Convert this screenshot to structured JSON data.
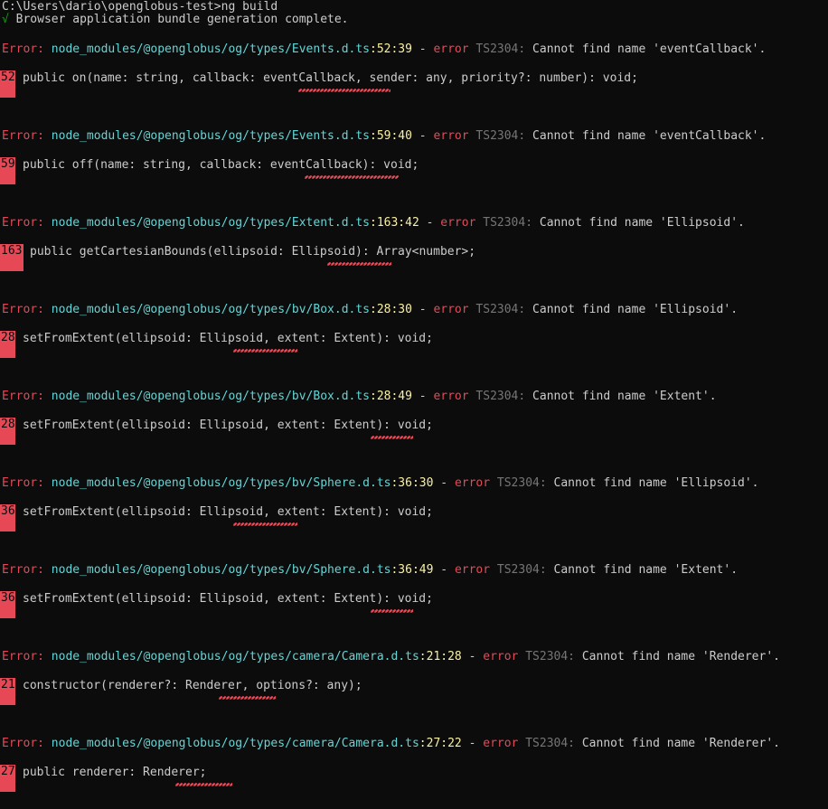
{
  "terminal": {
    "prompt": "C:\\Users\\dario\\openglobus-test>ng build",
    "success_check": "√",
    "success_text": " Browser application bundle generation complete.",
    "errors": [
      {
        "label": "Error:",
        "path": "node_modules/@openglobus/og/types/Events.d.ts",
        "loc": ":52:39",
        "dash": " - ",
        "severity": "error",
        "code": "TS2304:",
        "message": "Cannot find name 'eventCallback'.",
        "line_number": "52",
        "source": "    public on(name: string, callback: eventCallback, sender: any, priority?: number): void;",
        "squiggle": "~~~~~~~~~~~~~"
      },
      {
        "label": "Error:",
        "path": "node_modules/@openglobus/og/types/Events.d.ts",
        "loc": ":59:40",
        "dash": " - ",
        "severity": "error",
        "code": "TS2304:",
        "message": "Cannot find name 'eventCallback'.",
        "line_number": "59",
        "source": "    public off(name: string, callback: eventCallback): void;",
        "squiggle": "~~~~~~~~~~~~~"
      },
      {
        "label": "Error:",
        "path": "node_modules/@openglobus/og/types/Extent.d.ts",
        "loc": ":163:42",
        "dash": " - ",
        "severity": "error",
        "code": "TS2304:",
        "message": "Cannot find name 'Ellipsoid'.",
        "line_number": "163",
        "source": "    public getCartesianBounds(ellipsoid: Ellipsoid): Array<number>;",
        "squiggle": "~~~~~~~~~"
      },
      {
        "label": "Error:",
        "path": "node_modules/@openglobus/og/types/bv/Box.d.ts",
        "loc": ":28:30",
        "dash": " - ",
        "severity": "error",
        "code": "TS2304:",
        "message": "Cannot find name 'Ellipsoid'.",
        "line_number": "28",
        "source": "    setFromExtent(ellipsoid: Ellipsoid, extent: Extent): void;",
        "squiggle": "~~~~~~~~~"
      },
      {
        "label": "Error:",
        "path": "node_modules/@openglobus/og/types/bv/Box.d.ts",
        "loc": ":28:49",
        "dash": " - ",
        "severity": "error",
        "code": "TS2304:",
        "message": "Cannot find name 'Extent'.",
        "line_number": "28",
        "source": "    setFromExtent(ellipsoid: Ellipsoid, extent: Extent): void;",
        "squiggle": "~~~~~~"
      },
      {
        "label": "Error:",
        "path": "node_modules/@openglobus/og/types/bv/Sphere.d.ts",
        "loc": ":36:30",
        "dash": " - ",
        "severity": "error",
        "code": "TS2304:",
        "message": "Cannot find name 'Ellipsoid'.",
        "line_number": "36",
        "source": "    setFromExtent(ellipsoid: Ellipsoid, extent: Extent): void;",
        "squiggle": "~~~~~~~~~"
      },
      {
        "label": "Error:",
        "path": "node_modules/@openglobus/og/types/bv/Sphere.d.ts",
        "loc": ":36:49",
        "dash": " - ",
        "severity": "error",
        "code": "TS2304:",
        "message": "Cannot find name 'Extent'.",
        "line_number": "36",
        "source": "    setFromExtent(ellipsoid: Ellipsoid, extent: Extent): void;",
        "squiggle": "~~~~~~"
      },
      {
        "label": "Error:",
        "path": "node_modules/@openglobus/og/types/camera/Camera.d.ts",
        "loc": ":21:28",
        "dash": " - ",
        "severity": "error",
        "code": "TS2304:",
        "message": "Cannot find name 'Renderer'.",
        "line_number": "21",
        "source": "    constructor(renderer?: Renderer, options?: any);",
        "squiggle": "~~~~~~~~"
      },
      {
        "label": "Error:",
        "path": "node_modules/@openglobus/og/types/camera/Camera.d.ts",
        "loc": ":27:22",
        "dash": " - ",
        "severity": "error",
        "code": "TS2304:",
        "message": "Cannot find name 'Renderer'.",
        "line_number": "27",
        "source": "    public renderer: Renderer;",
        "squiggle": "~~~~~~~~"
      }
    ]
  },
  "colors": {
    "background": "#0c0c0c",
    "error_red": "#e74856",
    "path_cyan": "#61d6d6",
    "location_yellow": "#f9f1a5",
    "code_gray": "#767676",
    "text": "#cccccc",
    "success_green": "#13a10e"
  }
}
